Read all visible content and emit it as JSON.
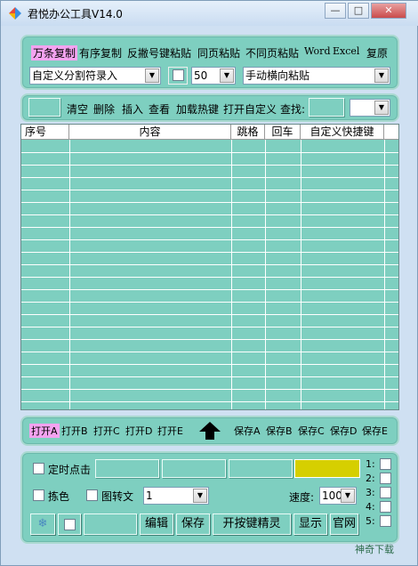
{
  "window": {
    "title": "君悦办公工具V14.0",
    "controls": [
      "—",
      "□",
      "✕"
    ]
  },
  "toolbar1": {
    "items": [
      "万条复制",
      "有序复制",
      "反撇号键粘贴",
      "同页粘贴",
      "不同页粘贴",
      "Word",
      "Excel",
      "复原"
    ],
    "selected_index": 0,
    "delimiter_combo": "自定义分割符录入",
    "count_combo": "50",
    "paste_mode_combo": "手动横向粘贴"
  },
  "toolbar2": {
    "items": [
      "清空",
      "删除",
      "插入",
      "查看",
      "加载热键",
      "打开自定义",
      "查找:"
    ]
  },
  "table": {
    "columns": [
      "序号",
      "内容",
      "跳格",
      "回车",
      "自定义快捷键"
    ]
  },
  "file_bar": {
    "open": [
      "打开A",
      "打开B",
      "打开C",
      "打开D",
      "打开E"
    ],
    "save": [
      "保存A",
      "保存B",
      "保存C",
      "保存D",
      "保存E"
    ],
    "selected_open_index": 0
  },
  "bottom": {
    "timer_label": "定时点击",
    "pick_color_label": "拣色",
    "image_to_text_label": "图转文",
    "mode_combo": "1",
    "speed_label": "速度:",
    "speed_combo": "100",
    "buttons": [
      "编辑",
      "保存",
      "开按键精灵",
      "显示",
      "官网"
    ],
    "side_checks": [
      "1:",
      "2:",
      "3:",
      "4:",
      "5:"
    ],
    "accent_color": "#d6cf00"
  },
  "watermark": "神奇下载"
}
